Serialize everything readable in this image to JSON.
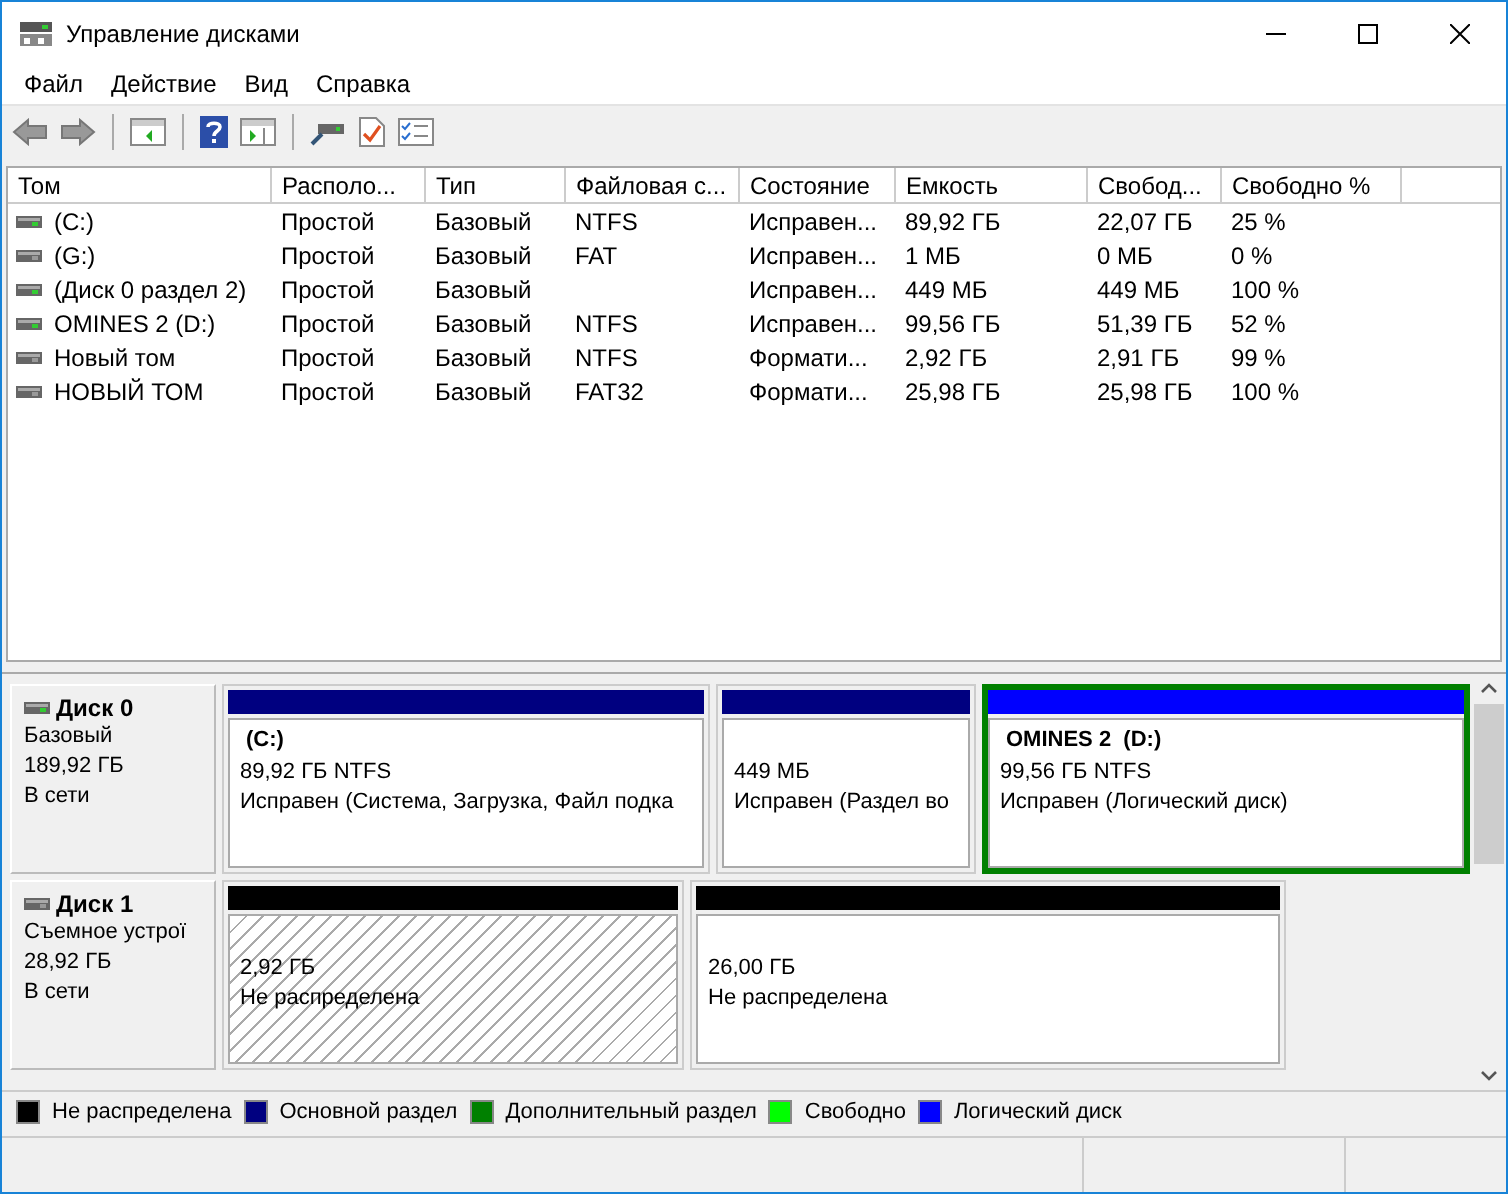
{
  "window": {
    "title": "Управление дисками"
  },
  "menu": [
    "Файл",
    "Действие",
    "Вид",
    "Справка"
  ],
  "volume_table": {
    "columns": [
      "Том",
      "Располо...",
      "Тип",
      "Файловая с...",
      "Состояние",
      "Емкость",
      "Свобод...",
      "Свободно %"
    ],
    "rows": [
      {
        "kind": "online",
        "cells": [
          "(C:)",
          "Простой",
          "Базовый",
          "NTFS",
          "Исправен...",
          "89,92 ГБ",
          "22,07 ГБ",
          "25 %"
        ]
      },
      {
        "kind": "offline",
        "cells": [
          "(G:)",
          "Простой",
          "Базовый",
          "FAT",
          "Исправен...",
          "1 МБ",
          "0 МБ",
          "0 %"
        ]
      },
      {
        "kind": "online",
        "cells": [
          "(Диск 0 раздел 2)",
          "Простой",
          "Базовый",
          "",
          "Исправен...",
          "449 МБ",
          "449 МБ",
          "100 %"
        ]
      },
      {
        "kind": "online",
        "cells": [
          "OMINES 2 (D:)",
          "Простой",
          "Базовый",
          "NTFS",
          "Исправен...",
          "99,56 ГБ",
          "51,39 ГБ",
          "52 %"
        ]
      },
      {
        "kind": "offline",
        "cells": [
          "Новый том",
          "Простой",
          "Базовый",
          "NTFS",
          "Формати...",
          "2,92 ГБ",
          "2,91 ГБ",
          "99 %"
        ]
      },
      {
        "kind": "offline",
        "cells": [
          "НОВЫЙ ТОМ",
          "Простой",
          "Базовый",
          "FAT32",
          "Формати...",
          "25,98 ГБ",
          "25,98 ГБ",
          "100 %"
        ]
      }
    ]
  },
  "disks": [
    {
      "name": "Диск 0",
      "kind": "online",
      "type": "Базовый",
      "size": "189,92 ГБ",
      "status": "В сети",
      "partitions": [
        {
          "name": "(C:)",
          "size": "89,92 ГБ NTFS",
          "status": "Исправен (Система, Загрузка, Файл подка",
          "color": "#000080",
          "selected": false,
          "hatched": false
        },
        {
          "size": "449 МБ",
          "status": "Исправен (Раздел во",
          "color": "#000080",
          "selected": false,
          "hatched": false
        },
        {
          "name": "OMINES 2  (D:)",
          "size": "99,56 ГБ NTFS",
          "status": "Исправен (Логический диск)",
          "color": "#0000ff",
          "selected": true,
          "hatched": false
        }
      ]
    },
    {
      "name": "Диск 1",
      "kind": "offline",
      "type": "Съемное устрої",
      "size": "28,92 ГБ",
      "status": "В сети",
      "partitions": [
        {
          "size": "2,92 ГБ",
          "status": "Не распределена",
          "color": "#000000",
          "selected": false,
          "hatched": true
        },
        {
          "size": "26,00 ГБ",
          "status": "Не распределена",
          "color": "#000000",
          "selected": false,
          "hatched": false
        }
      ]
    }
  ],
  "legend": [
    {
      "label": "Не распределена",
      "color": "#000000"
    },
    {
      "label": "Основной раздел",
      "color": "#000080"
    },
    {
      "label": "Дополнительный раздел",
      "color": "#008000"
    },
    {
      "label": "Свободно",
      "color": "#00ff00"
    },
    {
      "label": "Логический диск",
      "color": "#0000ff"
    }
  ]
}
